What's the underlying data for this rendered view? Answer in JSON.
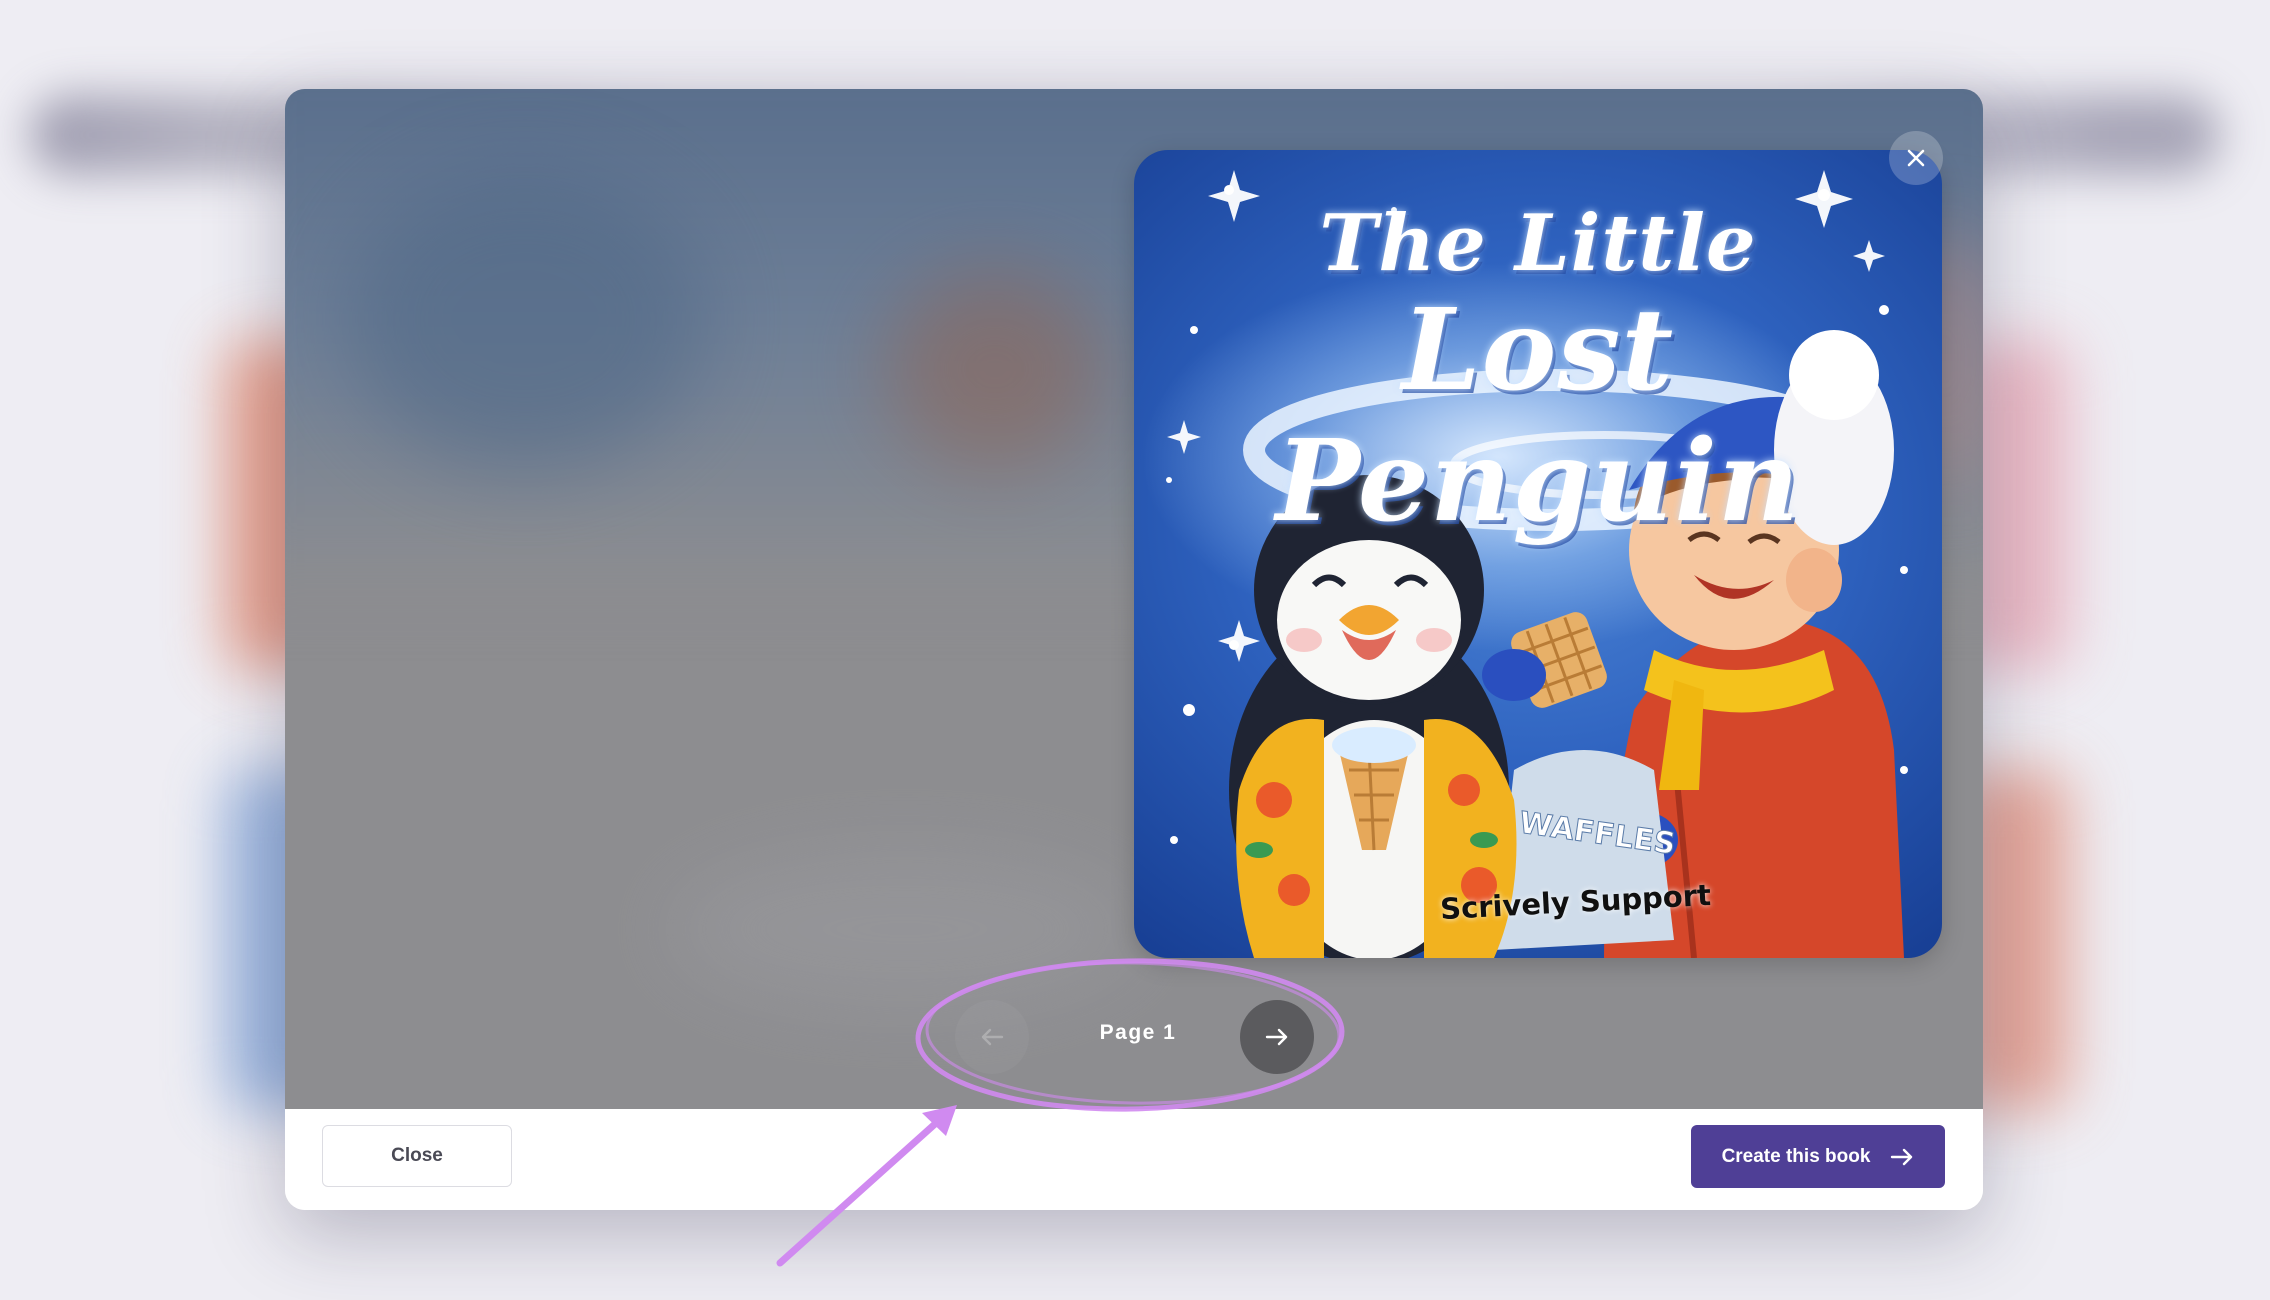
{
  "book": {
    "title_line1": "The Little",
    "title_line2": "Lost Penguin",
    "signature": "Scrively Support",
    "bag_label": "WAFFLES"
  },
  "pager": {
    "page_label": "Page 1",
    "prev_icon": "arrow-left-icon",
    "next_icon": "arrow-right-icon"
  },
  "modal": {
    "close_icon": "close-icon"
  },
  "footer": {
    "close_label": "Close",
    "create_label": "Create this book",
    "create_icon": "arrow-right-icon"
  },
  "colors": {
    "primary": "#4f3f96",
    "annotation": "#d08af0",
    "viewer_bg": "#8d8d90"
  }
}
